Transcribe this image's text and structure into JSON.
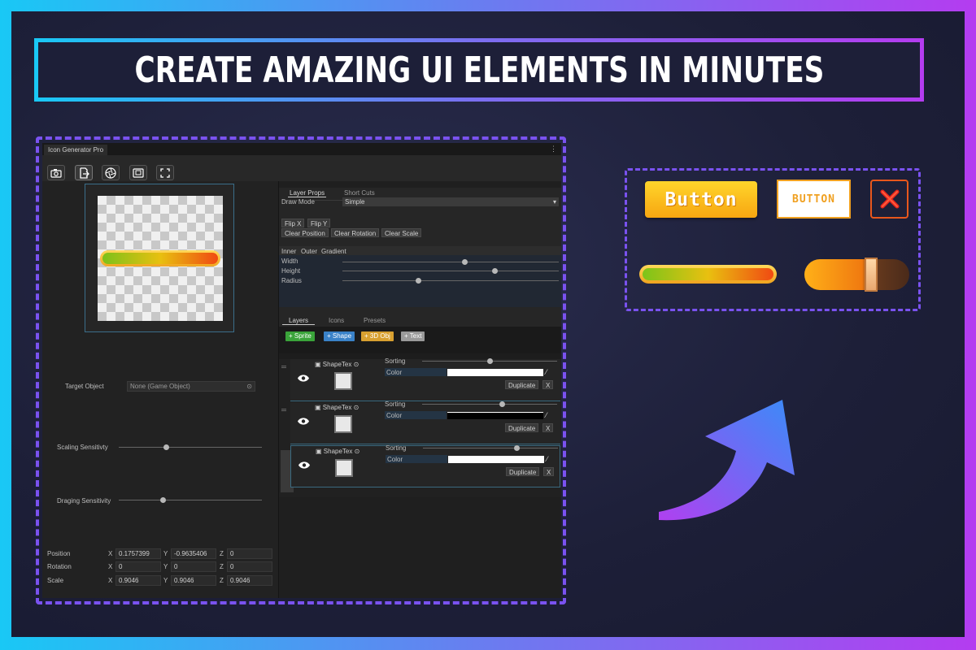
{
  "banner": {
    "title": "CREATE AMAZING UI ELEMENTS IN MINUTES"
  },
  "editor": {
    "window_tab": "Icon Generator Pro",
    "menu_icon": "⋮",
    "toolbar": [
      {
        "name": "camera-icon"
      },
      {
        "name": "export-icon"
      },
      {
        "name": "aperture-icon"
      },
      {
        "name": "frame-icon"
      },
      {
        "name": "fullscreen-icon"
      }
    ],
    "target_object": {
      "label": "Target Object",
      "value": "None (Game Object)"
    },
    "scaling_sensitivity": {
      "label": "Scaling Sensitivty",
      "level": 0.4
    },
    "dragging_sensitivity": {
      "label": "Draging Sensitivity",
      "level": 0.38
    },
    "transform": {
      "position": {
        "label": "Position",
        "x": "0.1757399",
        "y": "-0.9635406",
        "z": "0"
      },
      "rotation": {
        "label": "Rotation",
        "x": "0",
        "y": "0",
        "z": "0"
      },
      "scale": {
        "label": "Scale",
        "x": "0.9046",
        "y": "0.9046",
        "z": "0.9046"
      },
      "axis_x": "X",
      "axis_y": "Y",
      "axis_z": "Z"
    },
    "props_tabs": [
      "Layer Props",
      "Short Cuts"
    ],
    "draw_mode": {
      "label": "Draw Mode",
      "value": "Simple"
    },
    "flip_buttons": [
      "Flip X",
      "Flip Y"
    ],
    "clear_buttons": [
      "Clear Position",
      "Clear Rotation",
      "Clear Scale"
    ],
    "shape_tabs": [
      "Inner",
      "Outer",
      "Gradient"
    ],
    "shape_sliders": [
      {
        "label": "Width",
        "level": 0.56
      },
      {
        "label": "Height",
        "level": 0.7
      },
      {
        "label": "Radius",
        "level": 0.35
      }
    ],
    "list_tabs": [
      "Layers",
      "Icons",
      "Presets"
    ],
    "add_buttons": [
      {
        "label": "+ Sprite",
        "color": "#3aa43a"
      },
      {
        "label": "+ Shape",
        "color": "#3a82c8"
      },
      {
        "label": "+ 3D Obj",
        "color": "#d8a030"
      },
      {
        "label": "+ Text",
        "color": "#9a9a9a"
      }
    ],
    "layers": [
      {
        "name": "ShapeTex",
        "sorting_label": "Sorting",
        "sorting_level": 0.6,
        "color_label": "Color",
        "duplicate": "Duplicate",
        "remove": "X"
      },
      {
        "name": "ShapeTex",
        "sorting_label": "Sorting",
        "sorting_level": 0.68,
        "color_label": "Color",
        "duplicate": "Duplicate",
        "remove": "X"
      },
      {
        "name": "ShapeTex",
        "sorting_label": "Sorting",
        "sorting_level": 0.72,
        "color_label": "Color",
        "duplicate": "Duplicate",
        "remove": "X"
      }
    ]
  },
  "showcase": {
    "button_1": "Button",
    "button_2": "BUTTON",
    "close_icon": "close-x-icon",
    "progress_level": 0.95,
    "slider_level": 0.6
  },
  "colors": {
    "accent_cyan": "#19c8f5",
    "accent_purple": "#b43cf0",
    "dash": "#7a52f0",
    "orange": "#f7a611"
  }
}
